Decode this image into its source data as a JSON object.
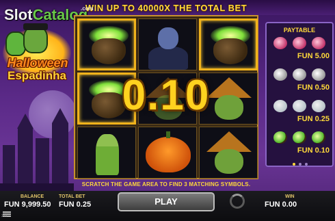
{
  "header": {
    "text": "WIN UP TO 40000X THE TOTAL BET"
  },
  "watermark": {
    "part1": "Slot",
    "part2": "Catalog",
    "suffix": ".com"
  },
  "logo": {
    "line1": "Halloween",
    "line2": "Espadinha"
  },
  "grid": {
    "cells": [
      {
        "symbol": "cauldron",
        "highlighted": true
      },
      {
        "symbol": "vampire",
        "highlighted": false
      },
      {
        "symbol": "cauldron",
        "highlighted": true
      },
      {
        "symbol": "cauldron",
        "highlighted": true
      },
      {
        "symbol": "witch",
        "highlighted": false
      },
      {
        "symbol": "witch",
        "highlighted": false
      },
      {
        "symbol": "skeleton",
        "highlighted": false
      },
      {
        "symbol": "pumpkin",
        "highlighted": false
      },
      {
        "symbol": "witch",
        "highlighted": false
      }
    ],
    "prize": "0.10"
  },
  "paytable": {
    "title": "PAYTABLE",
    "rows": [
      {
        "icon": "pink-creature-icon",
        "value": "FUN 5.00"
      },
      {
        "icon": "candle-icon",
        "value": "FUN 0.50"
      },
      {
        "icon": "ghost-icon",
        "value": "FUN 0.25"
      },
      {
        "icon": "cauldron-icon",
        "value": "FUN 0.10"
      }
    ],
    "page_indicator": {
      "pages": 3,
      "active": 0
    }
  },
  "instruction": "SCRATCH THE GAME AREA TO FIND 3 MATCHING SYMBOLS.",
  "bottom": {
    "balance_label": "BALANCE",
    "balance_value": "FUN 9,999.50",
    "total_bet_label": "TOTAL BET",
    "total_bet_value": "FUN 0.25",
    "play_label": "PLAY",
    "win_label": "WIN",
    "win_value": "FUN 0.00",
    "game_id": "240"
  },
  "colors": {
    "accent_gold": "#ffd93a",
    "background_purple": "#5b2a88",
    "cell_border_gold": "#f1b31c"
  }
}
